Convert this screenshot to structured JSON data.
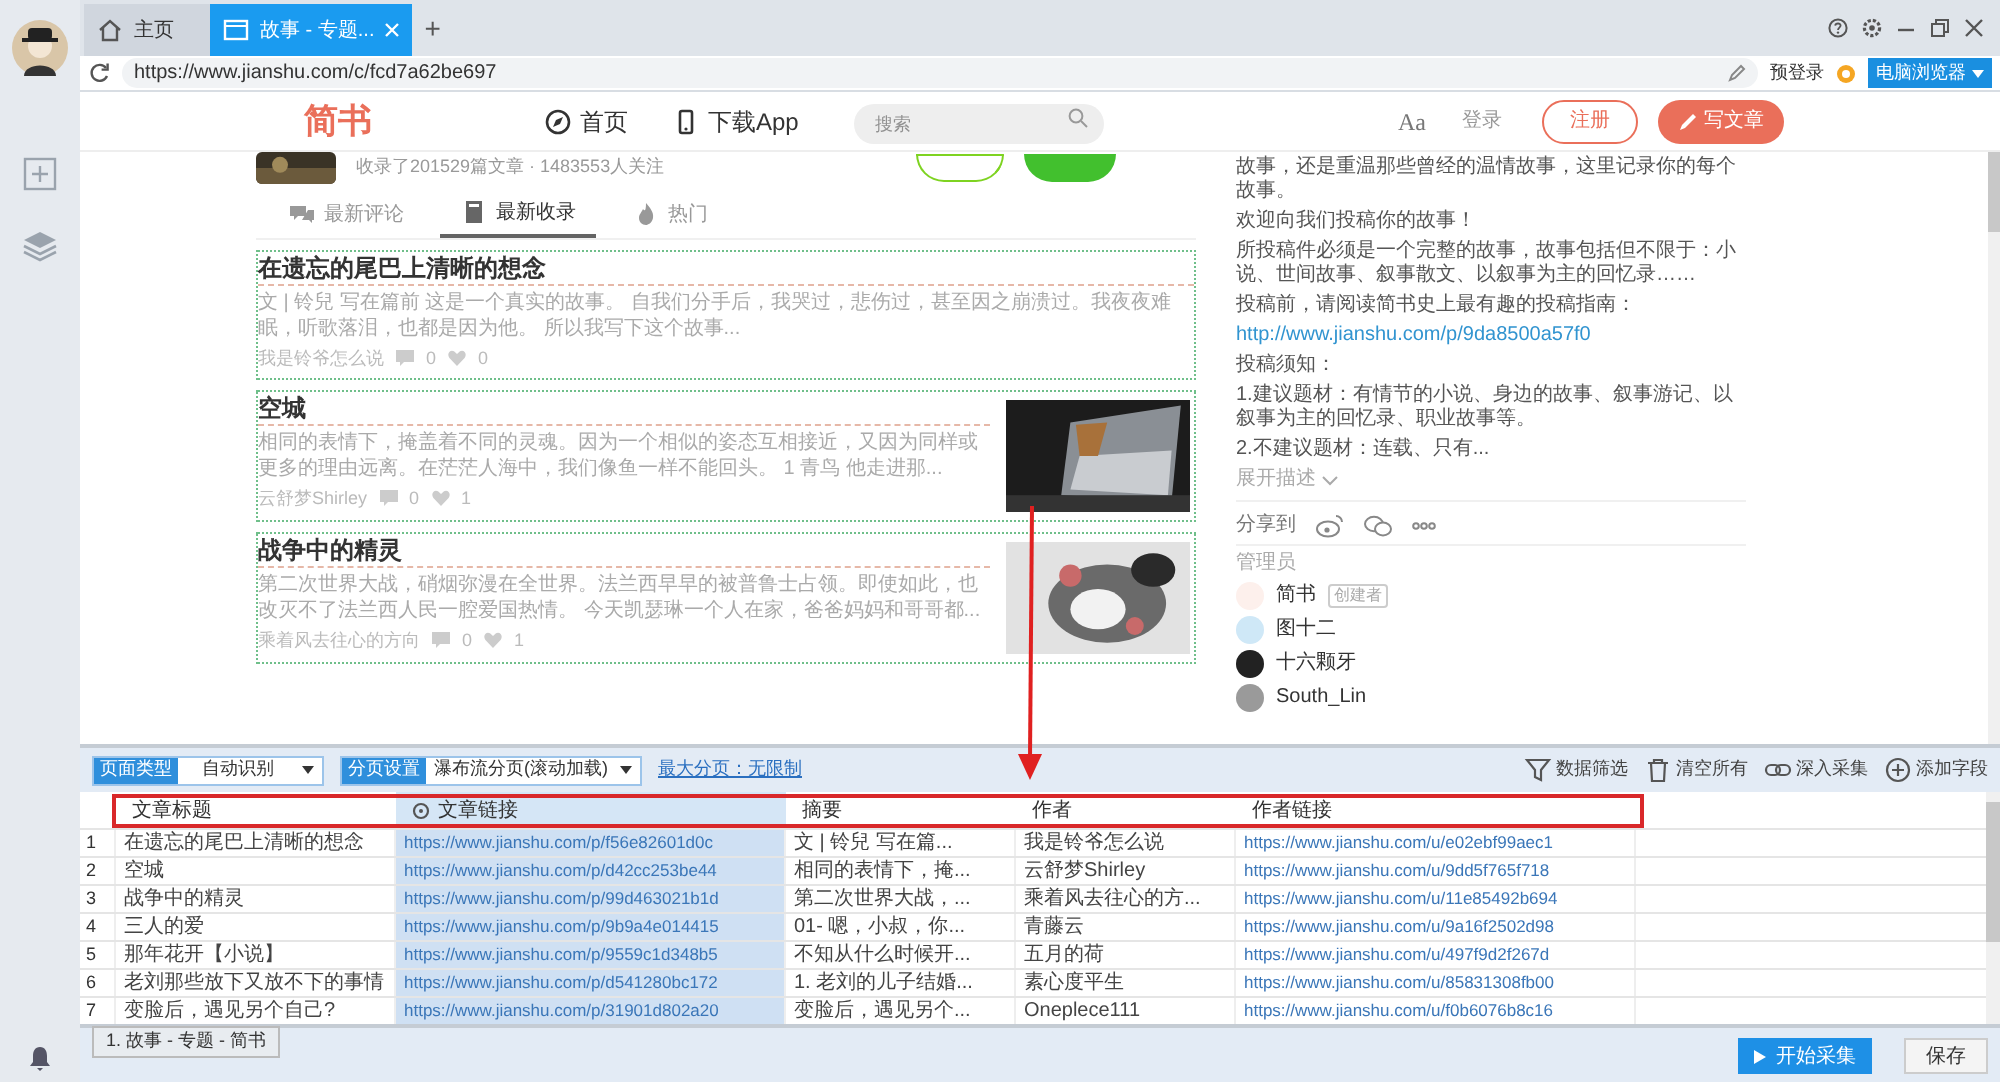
{
  "browser": {
    "tabs": [
      {
        "label": "主页",
        "kind": "home",
        "selected": false
      },
      {
        "label": "故事 - 专题...",
        "kind": "page",
        "selected": true
      }
    ],
    "new_tab": "+",
    "url": "https://www.jianshu.com/c/fcd7a62be697",
    "prelogin": "预登录",
    "mode_button": "电脑浏览器"
  },
  "site_header": {
    "logo": "简书",
    "nav": [
      {
        "label": "首页",
        "kind": "compass"
      },
      {
        "label": "下载App",
        "kind": "phone"
      }
    ],
    "search_placeholder": "搜索",
    "font_toggle": "Aa",
    "login": "登录",
    "register": "注册",
    "write": "写文章"
  },
  "collection": {
    "stats": "收录了201529篇文章 · 1483553人关注"
  },
  "feed_tabs": [
    {
      "label": "最新评论",
      "kind": "comments",
      "selected": false
    },
    {
      "label": "最新收录",
      "kind": "book",
      "selected": true
    },
    {
      "label": "热门",
      "kind": "flame",
      "selected": false
    }
  ],
  "articles": [
    {
      "title": "在遗忘的尾巴上清晰的想念",
      "summary": "文 | 铃兒 写在篇前 这是一个真实的故事。 自我们分手后，我哭过，悲伤过，甚至因之崩溃过。我夜夜难眠，听歌落泪，也都是因为他。 所以我写下这个故事...",
      "author": "我是铃爷怎么说",
      "comments": "0",
      "likes": "0"
    },
    {
      "title": "空城",
      "summary": "相同的表情下，掩盖着不同的灵魂。因为一个相似的姿态互相接近，又因为同样或更多的理由远离。在茫茫人海中，我们像鱼一样不能回头。 1 青鸟 他走进那...",
      "author": "云舒梦Shirley",
      "comments": "0",
      "likes": "1"
    },
    {
      "title": "战争中的精灵",
      "summary": "第二次世界大战，硝烟弥漫在全世界。法兰西早早的被普鲁士占领。即使如此，也改灭不了法兰西人民一腔爱国热情。 今天凯瑟琳一个人在家，爸爸妈妈和哥哥都...",
      "author": "乘着风去往心的方向",
      "comments": "0",
      "likes": "1"
    }
  ],
  "sidebar": {
    "paragraphs": [
      "故事，还是重温那些曾经的温情故事，这里记录你的每个故事。",
      "欢迎向我们投稿你的故事！",
      "所投稿件必须是一个完整的故事，故事包括但不限于：小说、世间故事、叙事散文、以叙事为主的回忆录……"
    ],
    "guide": {
      "text": "投稿前，请阅读简书史上最有趣的投稿指南：",
      "link": "http://www.jianshu.com/p/9da8500a57f0"
    },
    "notice": [
      "投稿须知：",
      "1.建议题材：有情节的小说、身边的故事、叙事游记、以叙事为主的回忆录、职业故事等。",
      "2.不建议题材：连载、只有..."
    ],
    "expand": "展开描述",
    "share_label": "分享到",
    "admins_label": "管理员",
    "admins": [
      {
        "name": "简书",
        "badge": "创建者",
        "color": "#fdf0ec"
      },
      {
        "name": "图十二",
        "color": "#cfe8f7"
      },
      {
        "name": "十六颗牙",
        "color": "#222222"
      },
      {
        "name": "South_Lin",
        "color": "#9a9a9a"
      }
    ]
  },
  "collector": {
    "page_type": {
      "label": "页面类型",
      "value": "自动识别"
    },
    "pagination": {
      "label": "分页设置",
      "value": "瀑布流分页(滚动加载)"
    },
    "max_pages": "最大分页：无限制",
    "actions": [
      {
        "label": "数据筛选",
        "kind": "filter"
      },
      {
        "label": "清空所有",
        "kind": "trash"
      },
      {
        "label": "深入采集",
        "kind": "link"
      },
      {
        "label": "添加字段",
        "kind": "plus"
      }
    ],
    "table": {
      "columns": [
        {
          "label": "文章标题",
          "kind": "text",
          "selected": false
        },
        {
          "label": "文章链接",
          "kind": "link",
          "selected": true
        },
        {
          "label": "摘要",
          "kind": "text",
          "selected": false
        },
        {
          "label": "作者",
          "kind": "text",
          "selected": false
        },
        {
          "label": "作者链接",
          "kind": "link",
          "selected": false
        }
      ],
      "rows": [
        {
          "number": "1",
          "cells": [
            "在遗忘的尾巴上清晰的想念",
            "https://www.jianshu.com/p/f56e82601d0c",
            "文 | 铃兒 写在篇...",
            "我是铃爷怎么说",
            "https://www.jianshu.com/u/e02ebf99aec1"
          ]
        },
        {
          "number": "2",
          "cells": [
            "空城",
            "https://www.jianshu.com/p/d42cc253be44",
            "相同的表情下，掩...",
            "云舒梦Shirley",
            "https://www.jianshu.com/u/9dd5f765f718"
          ]
        },
        {
          "number": "3",
          "cells": [
            "战争中的精灵",
            "https://www.jianshu.com/p/99d463021b1d",
            "第二次世界大战，...",
            "乘着风去往心的方...",
            "https://www.jianshu.com/u/11e85492b694"
          ]
        },
        {
          "number": "4",
          "cells": [
            "三人的爱",
            "https://www.jianshu.com/p/9b9a4e014415",
            "01- 嗯，小叔，你...",
            "青藤云",
            "https://www.jianshu.com/u/9a16f2502d98"
          ]
        },
        {
          "number": "5",
          "cells": [
            "那年花开【小说】",
            "https://www.jianshu.com/p/9559c1d348b5",
            "不知从什么时候开...",
            "五月的荷",
            "https://www.jianshu.com/u/497f9d2f267d"
          ]
        },
        {
          "number": "6",
          "cells": [
            "老刘那些放下又放不下的事情",
            "https://www.jianshu.com/p/d541280bc172",
            "1. 老刘的儿子结婚...",
            "素心度平生",
            "https://www.jianshu.com/u/85831308fb00"
          ]
        },
        {
          "number": "7",
          "cells": [
            "变脸后，遇见另个自己?",
            "https://www.jianshu.com/p/31901d802a20",
            "变脸后，遇见另个...",
            "Oneplece111",
            "https://www.jianshu.com/u/f0b6076b8c16"
          ]
        }
      ]
    },
    "task_tabs": [
      "1. 故事 - 专题 - 简书"
    ],
    "start": "开始采集",
    "save": "保存"
  }
}
